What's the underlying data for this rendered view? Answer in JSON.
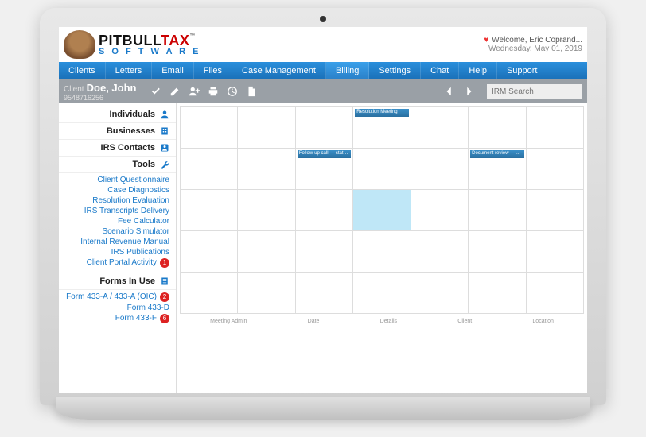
{
  "brand": {
    "line1_a": "PITBULL",
    "line1_b": "TAX",
    "tm": "™",
    "line2": "S O F T W A R E"
  },
  "welcome": {
    "greeting": "Welcome, Eric Coprand...",
    "date": "Wednesday, May 01, 2019"
  },
  "nav": {
    "clients": "Clients",
    "letters": "Letters",
    "email": "Email",
    "files": "Files",
    "casemgmt": "Case Management",
    "billing": "Billing",
    "settings": "Settings",
    "chat": "Chat",
    "help": "Help",
    "support": "Support"
  },
  "client": {
    "label": "Client",
    "name": "Doe, John",
    "id": "9548716256"
  },
  "search": {
    "placeholder": "IRM Search"
  },
  "sidebar": {
    "individuals": "Individuals",
    "businesses": "Businesses",
    "irscontacts": "IRS Contacts",
    "tools": "Tools",
    "tools_links": [
      "Client Questionnaire",
      "Case Diagnostics",
      "Resolution Evaluation",
      "IRS Transcripts Delivery",
      "Fee Calculator",
      "Scenario Simulator",
      "Internal Revenue Manual",
      "IRS Publications",
      "Client Portal Activity"
    ],
    "tools_badge_idx": 8,
    "tools_badge_val": "1",
    "formsinuse": "Forms In Use",
    "forms": [
      {
        "label": "Form 433-A / 433-A (OIC)",
        "badge": "2"
      },
      {
        "label": "Form 433-D",
        "badge": ""
      },
      {
        "label": "Form 433-F",
        "badge": "6"
      }
    ]
  },
  "calendar": {
    "events": {
      "r0c3": "Resolution Meeting",
      "r1c2": "Follow-up call — status review",
      "r1c5": "Document review — send update"
    },
    "footer": [
      "Meeting Admin",
      "Date",
      "Details",
      "Client",
      "Location"
    ]
  }
}
